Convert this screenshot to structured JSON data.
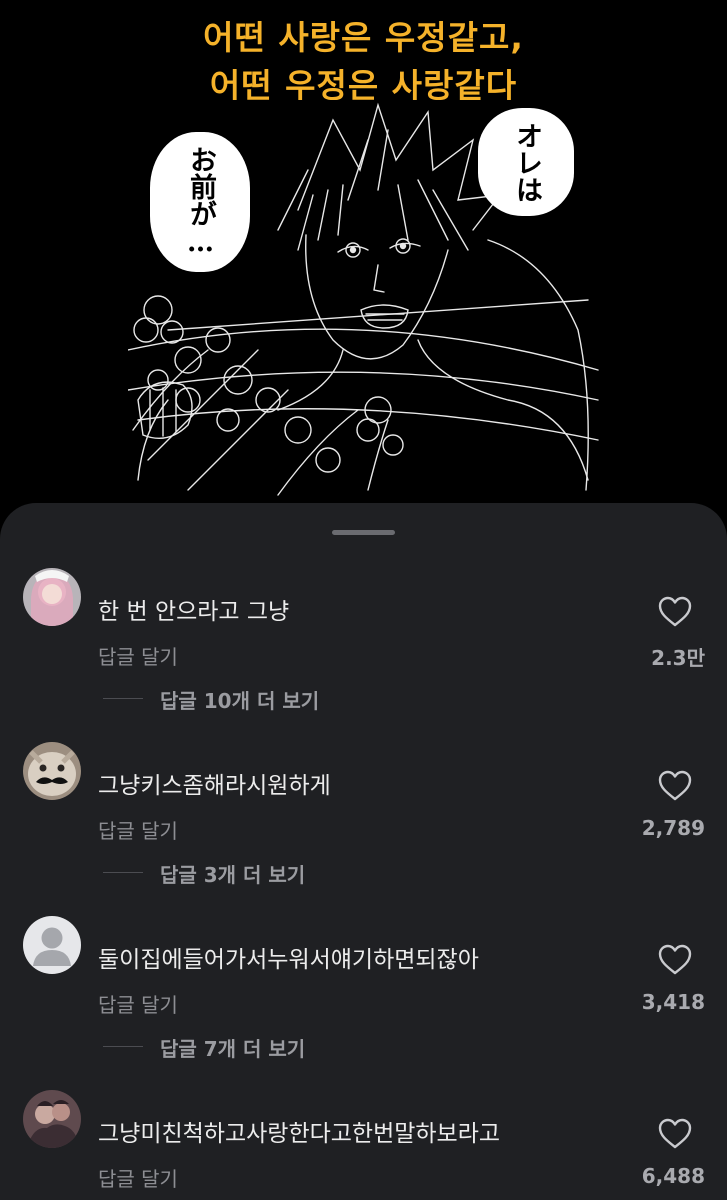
{
  "post": {
    "headline_line1": "어떤 사랑은 우정같고,",
    "headline_line2": "어떤 우정은 사랑같다",
    "bubble_left_text": "お前が…",
    "bubble_right_text": "オレは"
  },
  "comments": [
    {
      "text": "한 번 안으라고 그냥",
      "reply_label": "답글 달기",
      "likes": "2.3만",
      "more_replies": "답글 10개 더 보기",
      "avatar_icon": "profile-photo"
    },
    {
      "text": "그냥키스좀해라시원하게",
      "reply_label": "답글 달기",
      "likes": "2,789",
      "more_replies": "답글 3개 더 보기",
      "avatar_icon": "profile-photo"
    },
    {
      "text": "둘이집에들어가서누워서얘기하면되잖아",
      "reply_label": "답글 달기",
      "likes": "3,418",
      "more_replies": "답글 7개 더 보기",
      "avatar_icon": "default-user-icon"
    },
    {
      "text": "그냥미친척하고사랑한다고한번말하보라고",
      "reply_label": "답글 달기",
      "likes": "6,488",
      "avatar_icon": "profile-photo"
    }
  ],
  "colors": {
    "headline": "#f5b22a",
    "sheet_background": "#1f2023",
    "primary_text": "#ececec",
    "secondary_text": "#8d8e93"
  }
}
